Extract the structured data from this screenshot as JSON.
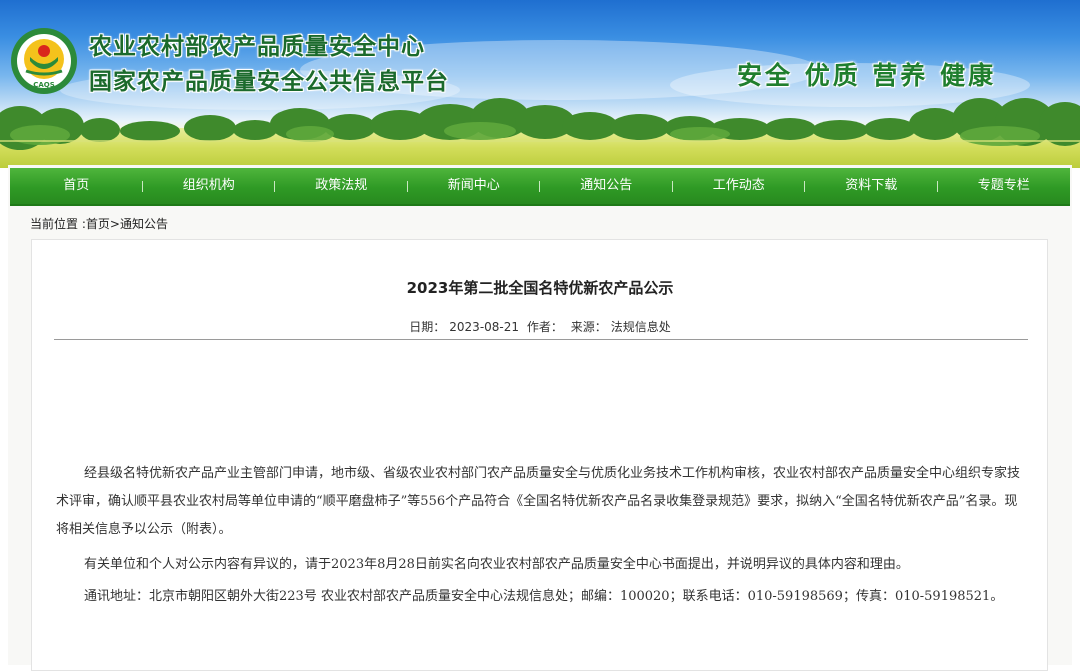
{
  "header": {
    "title_line1": "农业农村部农产品质量安全中心",
    "title_line2": "国家农产品质量安全公共信息平台",
    "slogan": "安全 优质 营养 健康",
    "logo_text": "CAQS",
    "colors": {
      "title": "#1b6a2c",
      "sky": "#3a8ee2",
      "field": "#c8d655"
    }
  },
  "nav": {
    "items": [
      "首页",
      "组织机构",
      "政策法规",
      "新闻中心",
      "通知公告",
      "工作动态",
      "资料下载",
      "专题专栏"
    ],
    "color": "#2f9a25"
  },
  "breadcrumb": {
    "prefix": "当前位置 :",
    "home": "首页",
    "sep": ">",
    "current": "通知公告"
  },
  "article": {
    "title": "2023年第二批全国名特优新农产品公示",
    "date_label": "日期：",
    "date": "2023-08-21",
    "author_label": "作者：",
    "source_label": "来源：",
    "source": "法规信息处",
    "paragraphs": [
      "经县级名特优新农产品产业主管部门申请，地市级、省级农业农村部门农产品质量安全与优质化业务技术工作机构审核，农业农村部农产品质量安全中心组织专家技术评审，确认顺平县农业农村局等单位申请的“顺平磨盘柿子”等556个产品符合《全国名特优新农产品名录收集登录规范》要求，拟纳入“全国名特优新农产品”名录。现将相关信息予以公示（附表）。",
      "有关单位和个人对公示内容有异议的，请于2023年8月28日前实名向农业农村部农产品质量安全中心书面提出，并说明异议的具体内容和理由。",
      "通讯地址：北京市朝阳区朝外大街223号 农业农村部农产品质量安全中心法规信息处；邮编：100020；联系电话：010-59198569；传真：010-59198521。"
    ]
  }
}
